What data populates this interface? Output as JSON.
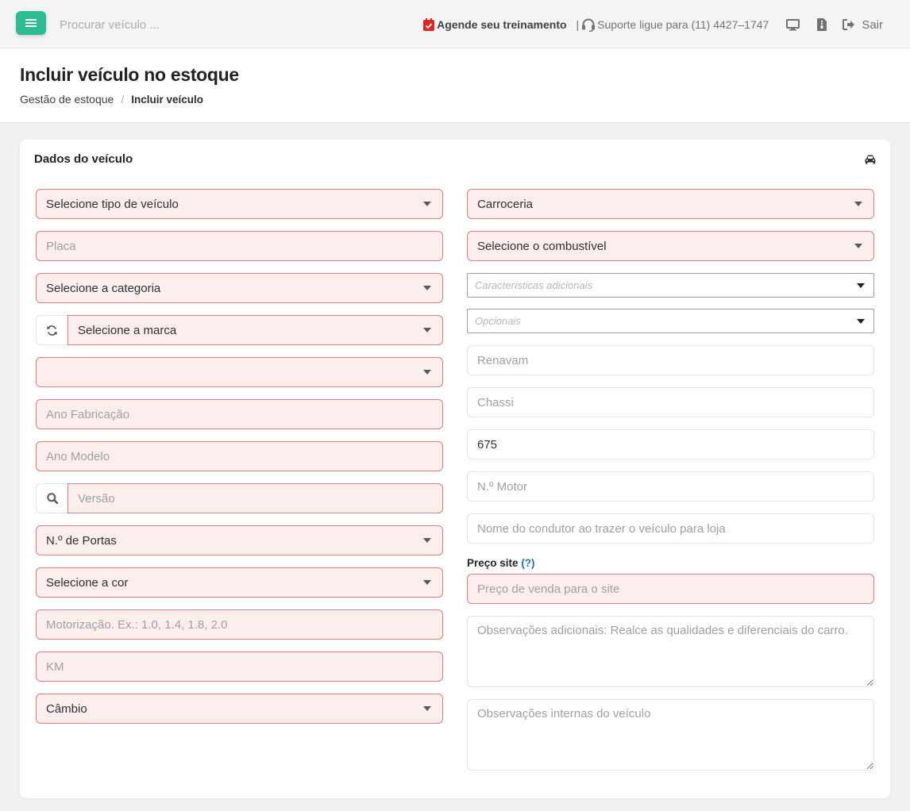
{
  "topbar": {
    "search_placeholder": "Procurar veículo ...",
    "agende_label": "Agende seu treinamento",
    "separator": "|",
    "suporte_label": "Suporte ligue para (11) 4427–1747",
    "sair_label": "Sair",
    "icons": [
      "menu-icon",
      "calendar-icon",
      "headset-icon",
      "monitor-icon",
      "document-icon",
      "logout-icon"
    ]
  },
  "header": {
    "title": "Incluir veículo no estoque",
    "breadcrumb": {
      "parent": "Gestão de estoque",
      "separator": "/",
      "current": "Incluir veículo"
    }
  },
  "card": {
    "title": "Dados do veículo",
    "icon": "car-icon"
  },
  "left_column": {
    "tipo_veiculo": "Selecione tipo de veículo",
    "placa_placeholder": "Placa",
    "categoria": "Selecione a categoria",
    "marca": "Selecione a marca",
    "modelo": "",
    "ano_fabricacao_placeholder": "Ano Fabricação",
    "ano_modelo_placeholder": "Ano Modelo",
    "versao_placeholder": "Versão",
    "portas": "N.º de Portas",
    "cor": "Selecione a cor",
    "motorizacao_placeholder": "Motorização. Ex.: 1.0, 1.4, 1.8, 2.0",
    "km_placeholder": "KM",
    "cambio": "Câmbio"
  },
  "right_column": {
    "carroceria": "Carroceria",
    "combustivel": "Selecione o combustível",
    "caracteristicas_placeholder": "Características adicionais",
    "opcionais_placeholder": "Opcionais",
    "renavam_placeholder": "Renavam",
    "chassi_placeholder": "Chassi",
    "field_value": "675",
    "motor_placeholder": "N.º Motor",
    "condutor_placeholder": "Nome do condutor ao trazer o veículo para loja",
    "preco_label": "Preço site",
    "preco_help": "(?)",
    "preco_placeholder": "Preço de venda para o site",
    "obs_adicionais_placeholder": "Observações adicionais: Realce as qualidades e diferenciais do carro.",
    "obs_internas_placeholder": "Observações internas do veículo"
  },
  "colors": {
    "accent": "#2dbb92",
    "error_border": "#e07e7e",
    "error_bg": "#fdeeee",
    "calendar_red": "#e02424",
    "help_blue": "#2a6fb0"
  }
}
